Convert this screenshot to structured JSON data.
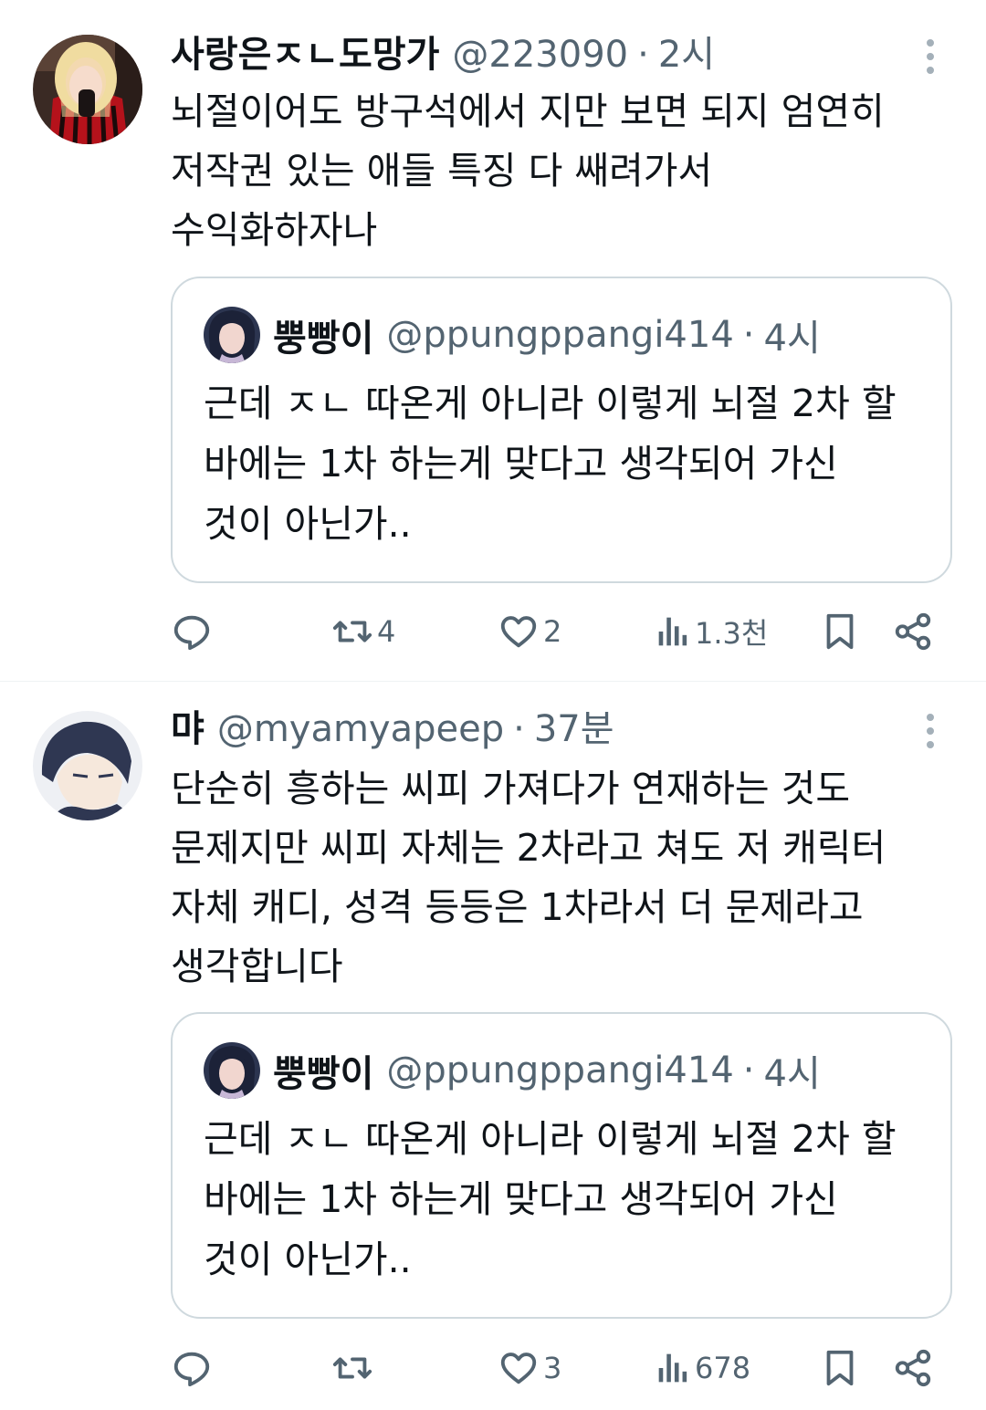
{
  "tweets": [
    {
      "display_name": "사랑은ㅈㄴ도망가",
      "handle": "@223090",
      "separator": "·",
      "time": "2시",
      "text": "뇌절이어도 방구석에서 지만 보면 되지 엄연히\n저작권 있는 애들 특징 다 쌔려가서\n수익화하자나",
      "quote": {
        "display_name": "뿡빵이",
        "handle": "@ppungppangi414",
        "separator": "·",
        "time": "4시",
        "text": "근데 ㅈㄴ 따온게 아니라 이렇게 뇌절 2차 할\n바에는 1차 하는게 맞다고 생각되어 가신\n것이 아닌가.."
      },
      "actions": {
        "replies": "",
        "retweets": "4",
        "likes": "2",
        "views": "1.3천"
      }
    },
    {
      "display_name": "먀",
      "handle": "@myamyapeep",
      "separator": "·",
      "time": "37분",
      "text": "단순히 흥하는 씨피 가져다가 연재하는 것도\n문제지만 씨피 자체는 2차라고 쳐도 저 캐릭터\n자체 캐디, 성격 등등은 1차라서 더 문제라고\n생각합니다",
      "quote": {
        "display_name": "뿡빵이",
        "handle": "@ppungppangi414",
        "separator": "·",
        "time": "4시",
        "text": "근데 ㅈㄴ 따온게 아니라 이렇게 뇌절 2차 할\n바에는 1차 하는게 맞다고 생각되어 가신\n것이 아닌가.."
      },
      "actions": {
        "replies": "",
        "retweets": "",
        "likes": "3",
        "views": "678"
      }
    }
  ],
  "icons": {
    "reply": "reply-icon",
    "retweet": "retweet-icon",
    "like": "heart-icon",
    "views": "views-icon",
    "bookmark": "bookmark-icon",
    "share": "share-icon",
    "more": "more-vertical-icon"
  },
  "colors": {
    "text_primary": "#0f1419",
    "text_secondary": "#536471",
    "border": "#cfd9de",
    "divider": "#eff3f4"
  }
}
